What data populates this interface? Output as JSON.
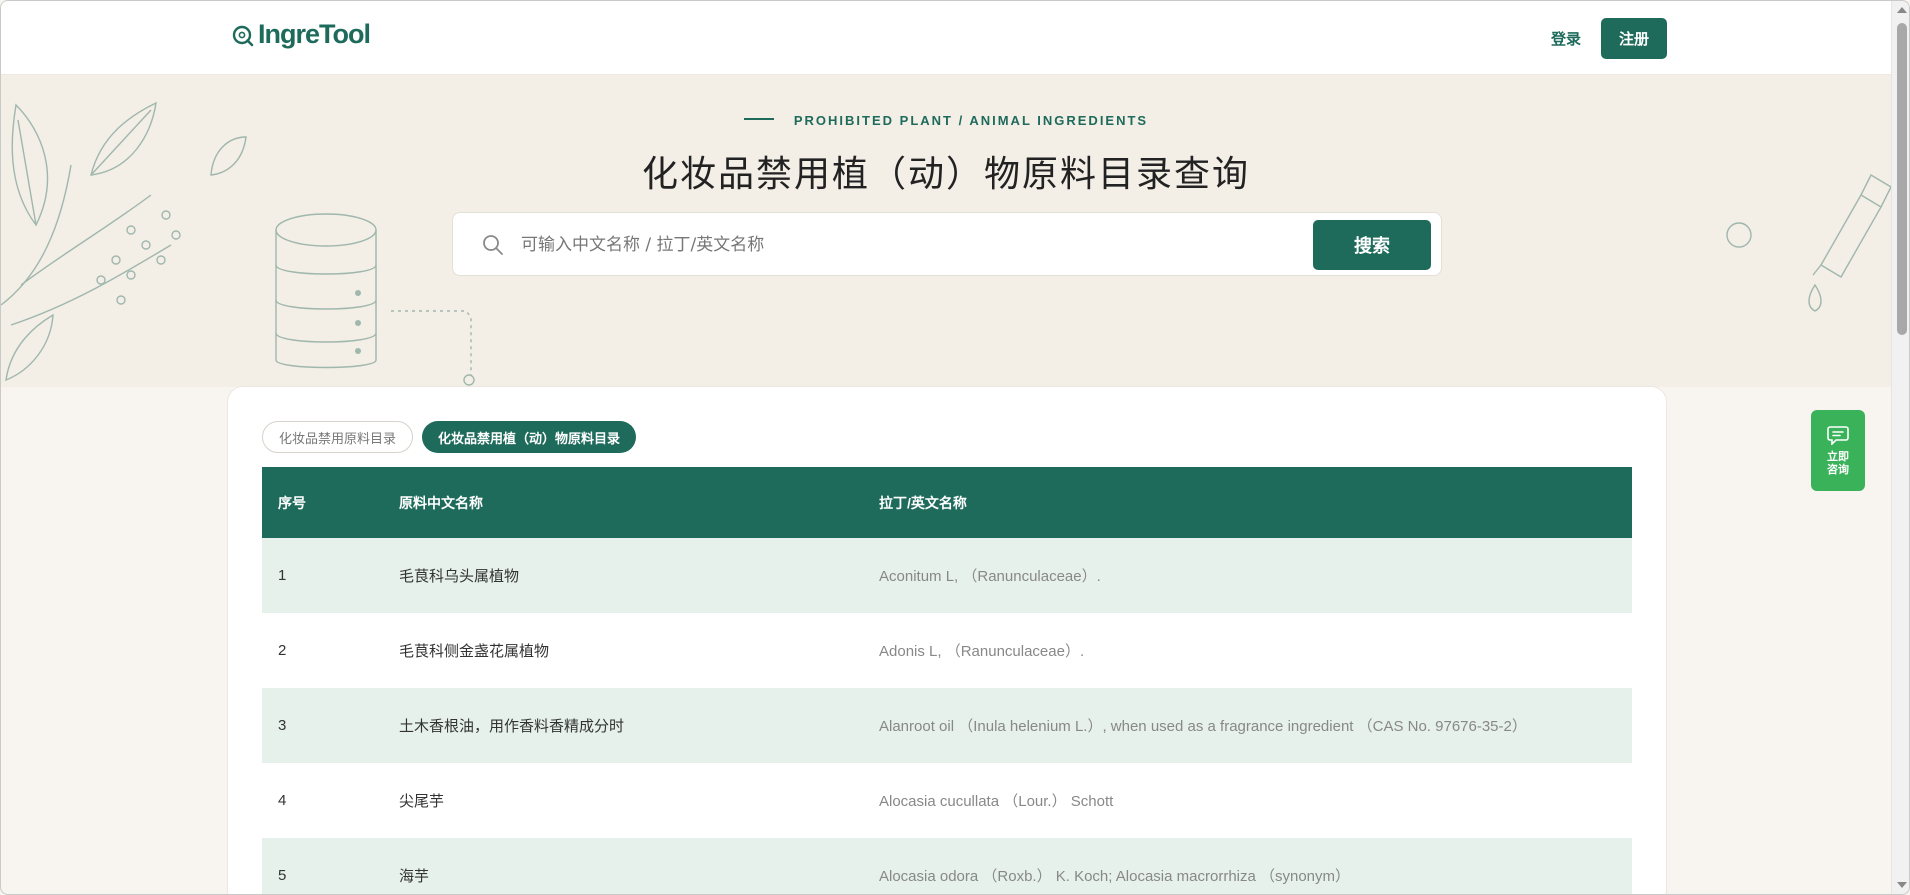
{
  "header": {
    "logo_text": "IngreTool",
    "login_label": "登录",
    "register_label": "注册"
  },
  "hero": {
    "eyebrow": "PROHIBITED PLANT / ANIMAL INGREDIENTS",
    "title": "化妆品禁用植（动）物原料目录查询",
    "search": {
      "placeholder": "可输入中文名称 / 拉丁/英文名称",
      "value": "",
      "button_label": "搜索"
    }
  },
  "tabs": [
    {
      "label": "化妆品禁用原料目录",
      "active": false
    },
    {
      "label": "化妆品禁用植（动）物原料目录",
      "active": true
    }
  ],
  "table": {
    "columns": [
      "序号",
      "原料中文名称",
      "拉丁/英文名称"
    ],
    "rows": [
      {
        "no": "1",
        "cn": "毛茛科乌头属植物",
        "en": "Aconitum L, （Ranunculaceae）."
      },
      {
        "no": "2",
        "cn": "毛茛科侧金盏花属植物",
        "en": "Adonis L, （Ranunculaceae）."
      },
      {
        "no": "3",
        "cn": "土木香根油，用作香料香精成分时",
        "en": "Alanroot oil （Inula helenium L.）, when used as a fragrance ingredient （CAS No. 97676-35-2）"
      },
      {
        "no": "4",
        "cn": "尖尾芋",
        "en": "Alocasia cucullata （Lour.） Schott"
      },
      {
        "no": "5",
        "cn": "海芋",
        "en": "Alocasia odora （Roxb.） K. Koch; Alocasia macrorrhiza （synonym）"
      }
    ]
  },
  "consult": {
    "label": "立即咨询"
  },
  "colors": {
    "brand": "#1e6b5c",
    "consult": "#3ab25a",
    "row_highlight": "#e6f1ec",
    "hero_bg": "#f3eee6"
  }
}
